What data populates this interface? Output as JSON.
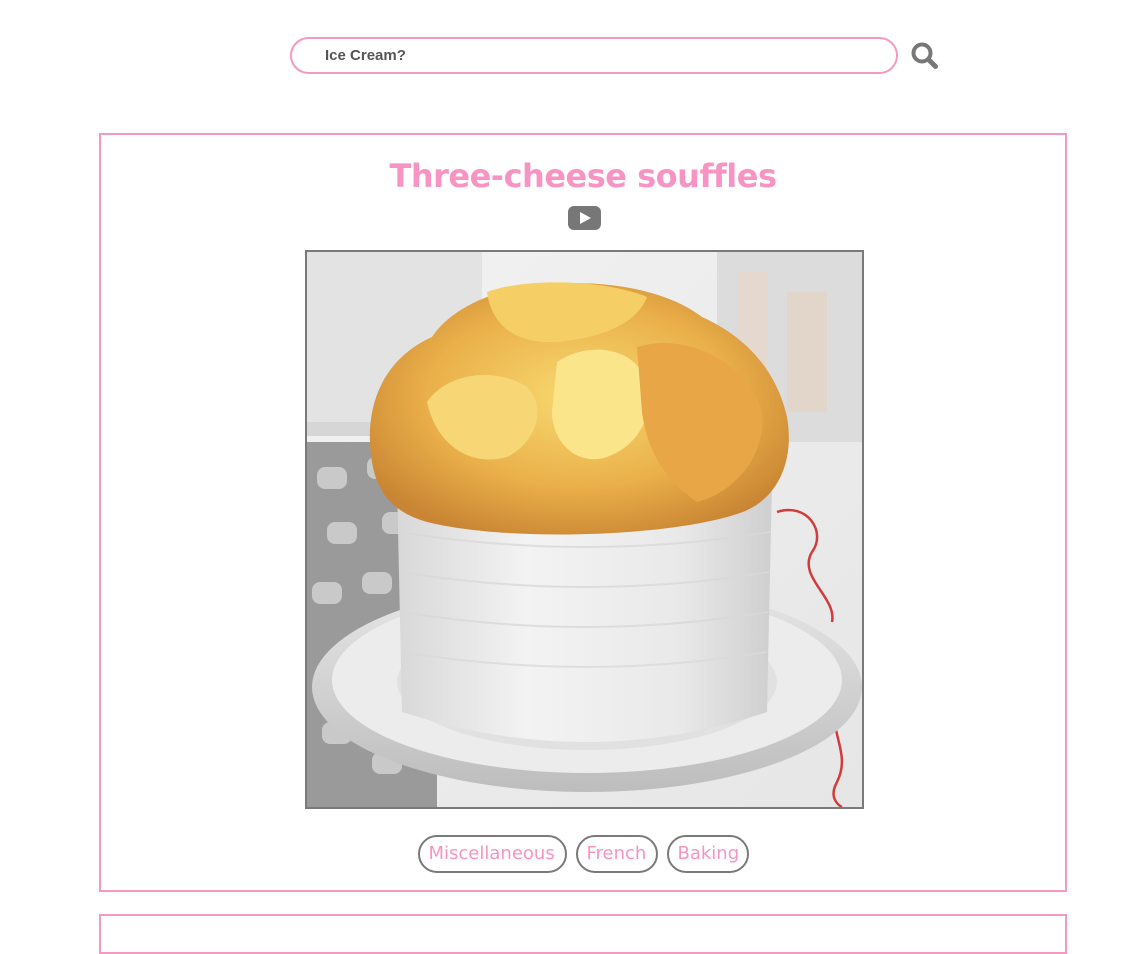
{
  "search": {
    "placeholder": "Ice Cream?",
    "value": "",
    "icon": "search-icon"
  },
  "recipe": {
    "title": "Three-cheese souffles",
    "video_icon": "youtube-play-icon",
    "image_alt": "souffle in white ramekin on plate",
    "tags": [
      "Miscellaneous",
      "French",
      "Baking"
    ]
  },
  "colors": {
    "accent_pink": "#f794c3",
    "border_pink": "#f49ac1",
    "icon_grey": "#777777"
  }
}
